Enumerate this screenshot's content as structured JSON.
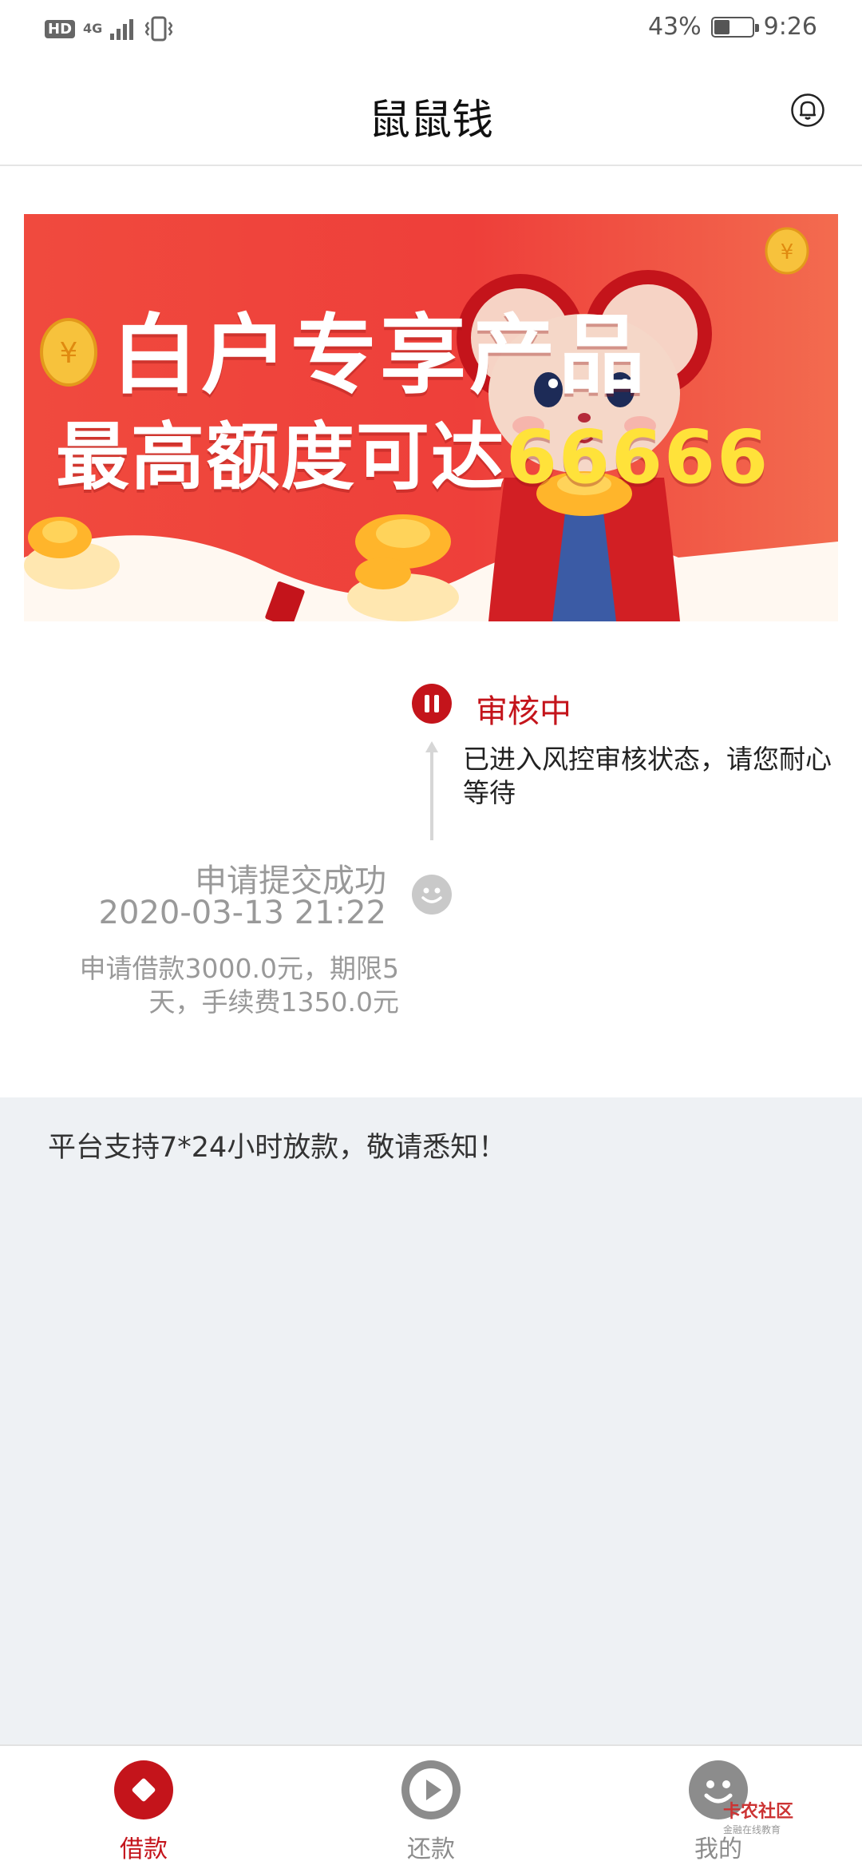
{
  "status_bar": {
    "hd": "HD",
    "network": "4G",
    "battery": "43%",
    "battery_level": 0.43,
    "time": "9:26"
  },
  "header": {
    "title": "鼠鼠钱"
  },
  "banner": {
    "line1": "白户专享产品",
    "line2_prefix": "最高额度可达",
    "line2_amount": "66666"
  },
  "timeline": {
    "current_status": "审核中",
    "current_desc": "已进入风控审核状态，请您耐心等待",
    "applied_title": "申请提交成功",
    "applied_time": "2020-03-13 21:22",
    "applied_detail": "申请借款3000.0元，期限5天，手续费1350.0元"
  },
  "notice": "平台支持7*24小时放款，敬请悉知！",
  "tabs": [
    {
      "label": "借款",
      "icon": "loan-icon",
      "active": true
    },
    {
      "label": "还款",
      "icon": "repay-play-icon",
      "active": false
    },
    {
      "label": "我的",
      "icon": "profile-smile-icon",
      "active": false
    }
  ],
  "watermark": {
    "title": "卡农社区",
    "subtitle": "金融在线教育"
  },
  "colors": {
    "brand_red": "#c4141b",
    "inactive_gray": "#8c8c8c",
    "notice_bg": "#eef1f4"
  }
}
